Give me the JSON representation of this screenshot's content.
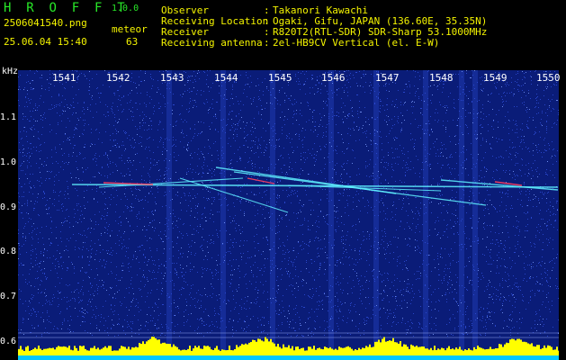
{
  "header": {
    "app_title": "H R O F F T",
    "app_version": "1.0.0",
    "file_name": "2506041540.png",
    "event_label": "meteor",
    "date_time": "25.06.04 15:40",
    "event_count": "63"
  },
  "station_info": [
    {
      "key": "Observer",
      "value": "Takanori Kawachi"
    },
    {
      "key": "Receiving Location",
      "value": "Ogaki, Gifu, JAPAN (136.60E, 35.35N)"
    },
    {
      "key": "Receiver",
      "value": "R820T2(RTL-SDR) SDR-Sharp 53.1000MHz"
    },
    {
      "key": "Receiving antenna",
      "value": "2el-HB9CV Vertical (el. E-W)"
    }
  ],
  "waterfall": {
    "y_unit": "kHz",
    "x_ticks": [
      "1541",
      "1542",
      "1543",
      "1544",
      "1545",
      "1546",
      "1547",
      "1548",
      "1549",
      "1550"
    ],
    "y_ticks": [
      "1.1",
      "1.0",
      "0.9",
      "0.8",
      "0.7",
      "0.6"
    ],
    "colors": {
      "background": "#0a1c78",
      "noise": "#2b4ad0",
      "echo_trace": "#5ff0ff",
      "echo_core": "#ff4060",
      "level_bars": "#ffff00",
      "baseline": "#00c8ff"
    }
  }
}
